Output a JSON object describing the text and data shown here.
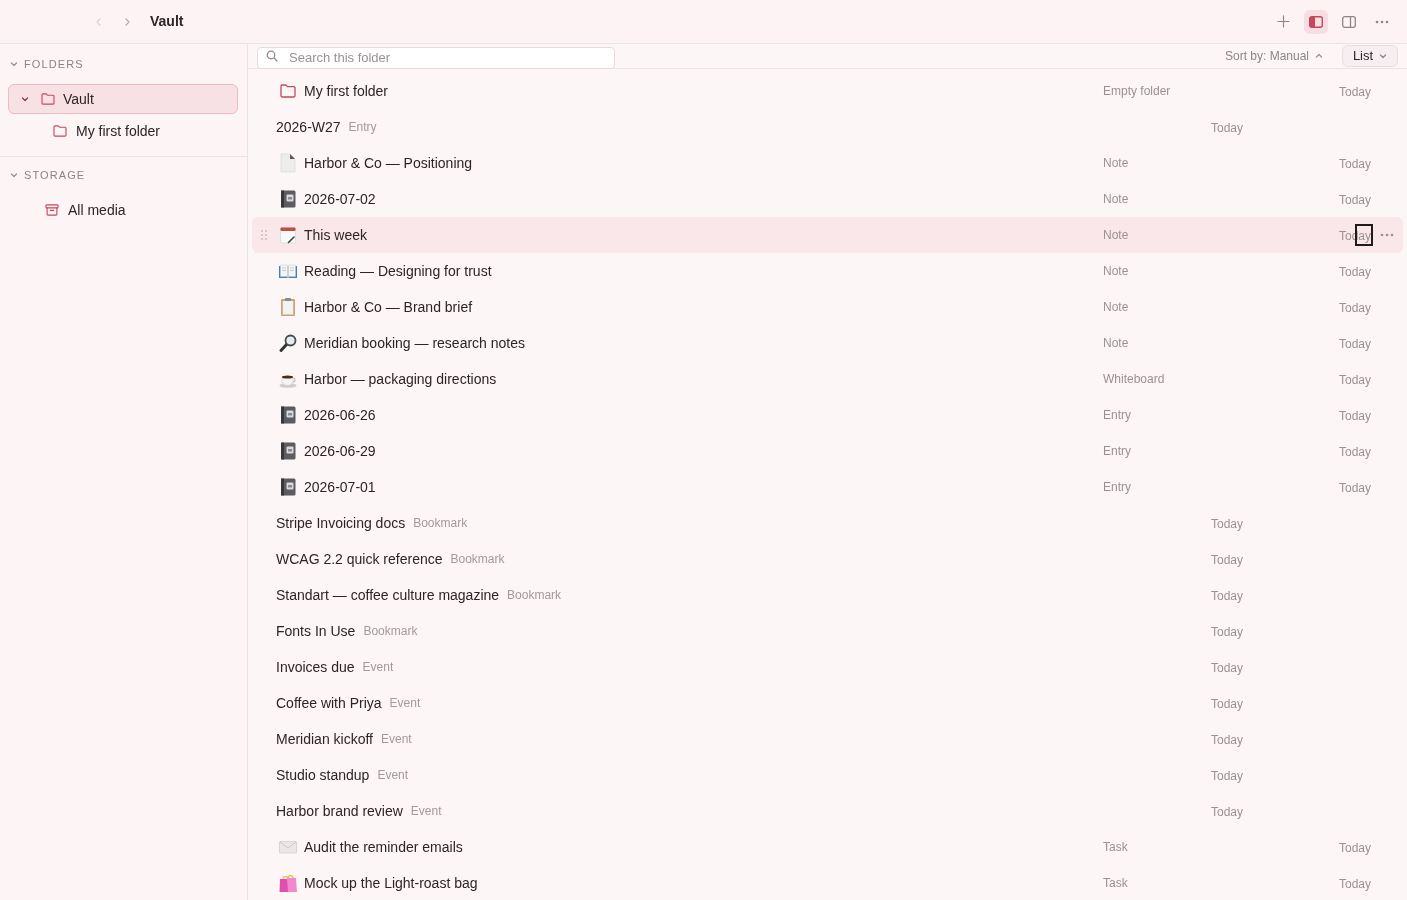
{
  "window": {
    "title": "Vault"
  },
  "nav": {
    "back": {
      "disabled": true
    },
    "forward": {
      "disabled": false
    }
  },
  "toolbar": [
    {
      "kind": "add",
      "selected": false
    },
    {
      "kind": "sidebar",
      "selected": true
    },
    {
      "kind": "split",
      "selected": false
    },
    {
      "kind": "more",
      "selected": false
    }
  ],
  "sidebar": {
    "sections": [
      {
        "title": "FOLDERS",
        "expanded": true,
        "items": [
          {
            "label": "Vault",
            "kind": "folder",
            "selected": true,
            "expanded": true,
            "children": [
              {
                "label": "My first folder",
                "kind": "folder",
                "selected": false
              }
            ]
          }
        ]
      },
      {
        "title": "STORAGE",
        "expanded": true,
        "items": [
          {
            "label": "All media",
            "kind": "media",
            "selected": false
          }
        ]
      }
    ]
  },
  "search": {
    "placeholder": "Search this folder"
  },
  "sort": {
    "label": "Sort by: Manual",
    "ascending": true
  },
  "view": {
    "label": "List"
  },
  "rows": [
    {
      "kind": "folder",
      "title": "My first folder",
      "type": "Empty folder",
      "date": "Today",
      "hovered": false,
      "focused": false
    },
    {
      "kind": "inline",
      "title": "2026-W27",
      "type": "Entry",
      "date": "Today",
      "hovered": false,
      "focused": false
    },
    {
      "kind": "document",
      "title": "Harbor & Co — Positioning",
      "type": "Note",
      "date": "Today",
      "hovered": false,
      "focused": false
    },
    {
      "kind": "notebook",
      "title": "2026-07-02",
      "type": "Note",
      "date": "Today",
      "hovered": false,
      "focused": false
    },
    {
      "kind": "calendar",
      "title": "This week",
      "type": "Note",
      "date": "Today",
      "hovered": true,
      "focused": true
    },
    {
      "kind": "book",
      "title": "Reading — Designing for trust",
      "type": "Note",
      "date": "Today",
      "hovered": false,
      "focused": false
    },
    {
      "kind": "clipboard",
      "title": "Harbor & Co — Brand brief",
      "type": "Note",
      "date": "Today",
      "hovered": false,
      "focused": false
    },
    {
      "kind": "magnifier",
      "title": "Meridian booking — research notes",
      "type": "Note",
      "date": "Today",
      "hovered": false,
      "focused": false
    },
    {
      "kind": "coffee",
      "title": "Harbor — packaging directions",
      "type": "Whiteboard",
      "date": "Today",
      "hovered": false,
      "focused": false
    },
    {
      "kind": "notebook",
      "title": "2026-06-26",
      "type": "Entry",
      "date": "Today",
      "hovered": false,
      "focused": false
    },
    {
      "kind": "notebook",
      "title": "2026-06-29",
      "type": "Entry",
      "date": "Today",
      "hovered": false,
      "focused": false
    },
    {
      "kind": "notebook",
      "title": "2026-07-01",
      "type": "Entry",
      "date": "Today",
      "hovered": false,
      "focused": false
    },
    {
      "kind": "inline",
      "title": "Stripe Invoicing docs",
      "type": "Bookmark",
      "date": "Today",
      "hovered": false,
      "focused": false
    },
    {
      "kind": "inline",
      "title": "WCAG 2.2 quick reference",
      "type": "Bookmark",
      "date": "Today",
      "hovered": false,
      "focused": false
    },
    {
      "kind": "inline",
      "title": "Standart — coffee culture magazine",
      "type": "Bookmark",
      "date": "Today",
      "hovered": false,
      "focused": false
    },
    {
      "kind": "inline",
      "title": "Fonts In Use",
      "type": "Bookmark",
      "date": "Today",
      "hovered": false,
      "focused": false
    },
    {
      "kind": "inline",
      "title": "Invoices due",
      "type": "Event",
      "date": "Today",
      "hovered": false,
      "focused": false
    },
    {
      "kind": "inline",
      "title": "Coffee with Priya",
      "type": "Event",
      "date": "Today",
      "hovered": false,
      "focused": false
    },
    {
      "kind": "inline",
      "title": "Meridian kickoff",
      "type": "Event",
      "date": "Today",
      "hovered": false,
      "focused": false
    },
    {
      "kind": "inline",
      "title": "Studio standup",
      "type": "Event",
      "date": "Today",
      "hovered": false,
      "focused": false
    },
    {
      "kind": "inline",
      "title": "Harbor brand review",
      "type": "Event",
      "date": "Today",
      "hovered": false,
      "focused": false
    },
    {
      "kind": "envelope",
      "title": "Audit the reminder emails",
      "type": "Task",
      "date": "Today",
      "hovered": false,
      "focused": false
    },
    {
      "kind": "bags",
      "title": "Mock up the Light-roast bag",
      "type": "Task",
      "date": "Today",
      "hovered": false,
      "focused": false
    }
  ]
}
